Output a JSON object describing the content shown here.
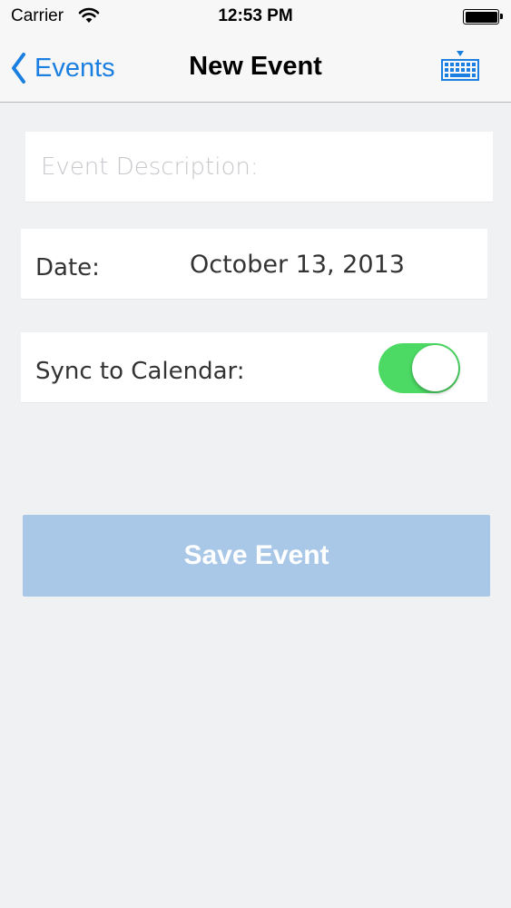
{
  "status_bar": {
    "carrier": "Carrier",
    "time": "12:53 PM",
    "icons": [
      "wifi-icon",
      "battery-icon"
    ]
  },
  "nav": {
    "back_label": "Events",
    "title": "New Event",
    "icons": [
      "chevron-left-icon",
      "keyboard-icon"
    ]
  },
  "form": {
    "description_placeholder": "Event Description:",
    "description_value": "",
    "date_label": "Date:",
    "date_value": "October 13, 2013",
    "sync_label": "Sync to Calendar:",
    "sync_on": true
  },
  "actions": {
    "save_label": "Save Event"
  },
  "colors": {
    "accent": "#1a7fe0",
    "toggle_on": "#4cd964",
    "save_button": "#a9c8e8",
    "background": "#eff1f3"
  }
}
